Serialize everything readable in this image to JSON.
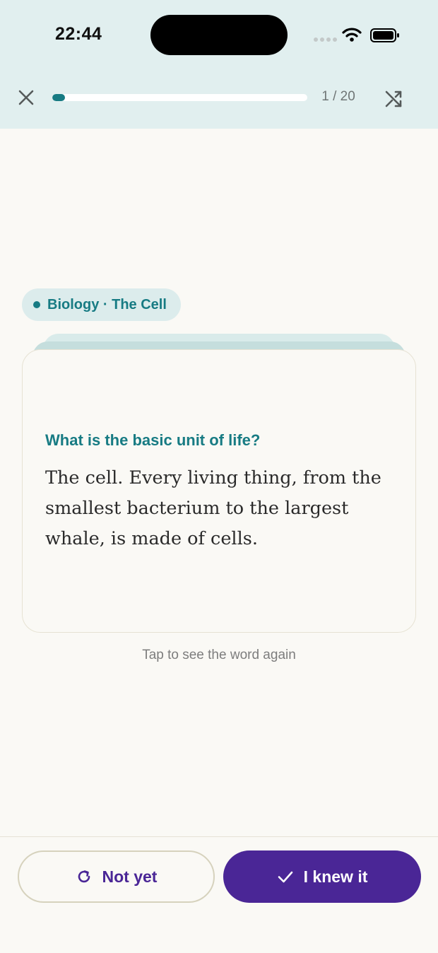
{
  "status_bar": {
    "time": "22:44"
  },
  "header": {
    "progress": {
      "current": 1,
      "total": 20,
      "fraction": 0.05
    },
    "counter_text": "1 / 20"
  },
  "deck": {
    "chip_label": "Biology · The Cell"
  },
  "card": {
    "question": "What is the basic unit of life?",
    "answer": "The cell. Every living thing, from the smallest bacterium to the largest whale, is made of cells."
  },
  "hint": "Tap to see the word again",
  "actions": {
    "not_yet_label": "Not yet",
    "knew_it_label": "I knew it"
  },
  "colors": {
    "header_bg": "#e1efef",
    "teal_accent": "#177b83",
    "purple_accent": "#4a2696",
    "page_bg": "#faf9f5"
  },
  "icons": [
    "close-icon",
    "shuffle-icon",
    "refresh-icon",
    "check-icon",
    "wifi-icon",
    "battery-icon"
  ]
}
